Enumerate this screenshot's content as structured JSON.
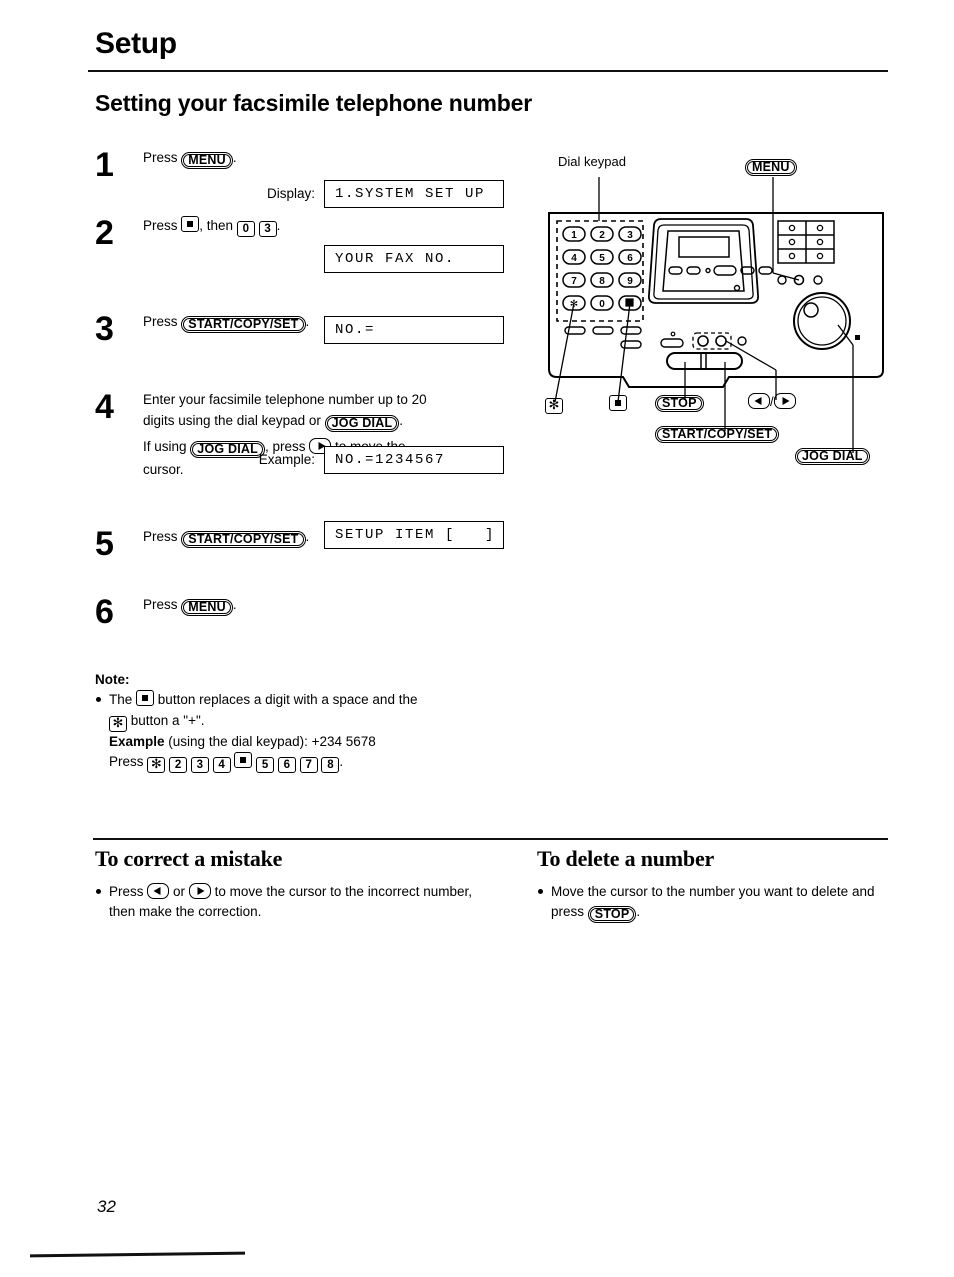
{
  "header": {
    "chapter": "Setup",
    "section_title": "Setting your facsimile telephone number"
  },
  "steps": [
    {
      "num": "1",
      "line1_pre": "Press",
      "button": "MENU",
      "line1_post": ".",
      "display_label": "Display:",
      "lcd": "1.SYSTEM SET UP"
    },
    {
      "num": "2",
      "line1_pre": "Press",
      "line1_mid": ", then",
      "line1_post": ".",
      "key_hash": "#",
      "key_0": "0",
      "key_3": "3",
      "lcd": "YOUR FAX NO."
    },
    {
      "num": "3",
      "line1_pre": "Press",
      "button": "START/COPY/SET",
      "line1_post": ".",
      "lcd": "NO.="
    },
    {
      "num": "4",
      "line1": "Enter your facsimile telephone number up to 20",
      "line2_pre": "digits using the dial keypad or",
      "button_jog": "JOG DIAL",
      "line2_post": ".",
      "line3_pre": "If using",
      "line3_mid": ", press",
      "line3_post": "to move the",
      "line4": "cursor.",
      "example_label": "Example:",
      "lcd": "NO.=1234567"
    },
    {
      "num": "5",
      "line1_pre": "Press",
      "button": "START/COPY/SET",
      "line1_post": ".",
      "lcd": "SETUP ITEM [   ]"
    },
    {
      "num": "6",
      "line1_pre": "Press",
      "button": "MENU",
      "line1_post": "."
    }
  ],
  "note": {
    "heading": "Note:",
    "line1_pre": "The",
    "line1_mid": "button replaces a digit with a space and the",
    "line2_mid": "button a \"+\".",
    "example_bold": "Example",
    "example_rest": "(using the dial keypad):  +234  5678",
    "press_label": "Press",
    "press_keys": [
      "✻",
      "2",
      "3",
      "4",
      "#",
      "5",
      "6",
      "7",
      "8"
    ],
    "press_end": "."
  },
  "bottom": {
    "left": {
      "heading": "To correct a mistake",
      "line1_pre": "Press",
      "line1_mid": "or",
      "line1_post": "to move the cursor to the",
      "line2": "incorrect number, then make the correction."
    },
    "right": {
      "heading": "To delete a number",
      "line1": "Move the cursor to the number you want to",
      "line2_pre": "delete and press",
      "button": "STOP",
      "line2_post": "."
    }
  },
  "figure": {
    "callouts": {
      "dial_keypad": "Dial keypad",
      "menu": "MENU",
      "star": "✻",
      "hash": "#",
      "stop": "STOP",
      "start_copy_set": "START/COPY/SET",
      "arrows": "/",
      "jog_dial": "JOG DIAL"
    },
    "keypad_keys": [
      "1",
      "2",
      "3",
      "4",
      "5",
      "6",
      "7",
      "8",
      "9",
      "✻",
      "0",
      "#"
    ]
  },
  "footer": {
    "page_number": "32"
  }
}
